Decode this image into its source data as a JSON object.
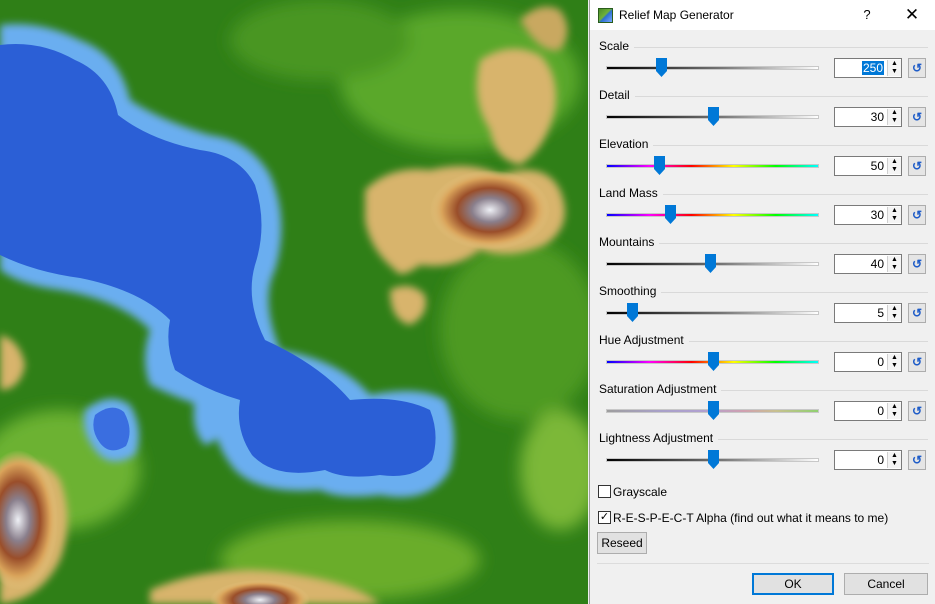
{
  "dialog": {
    "title": "Relief Map Generator",
    "help_label": "?",
    "close_label": "✕",
    "icon": "relief-map-app-icon",
    "accent_color": "#0078d7"
  },
  "map": {
    "icon": "terrain-preview",
    "colors": {
      "water_deep": "#2b5fd6",
      "water_shallow": "#6aaef0",
      "lowland": "#2f7f17",
      "grass": "#58a824",
      "hill": "#d9b36a",
      "mountain": "#9a4e2a",
      "snow": "#eef0f5"
    }
  },
  "controls": [
    {
      "label": "Scale",
      "value": "250",
      "slider_fraction": 0.26,
      "track": "gray",
      "selected": true
    },
    {
      "label": "Detail",
      "value": "30",
      "slider_fraction": 0.5,
      "track": "gray",
      "selected": false
    },
    {
      "label": "Elevation",
      "value": "50",
      "slider_fraction": 0.25,
      "track": "hue",
      "selected": false
    },
    {
      "label": "Land Mass",
      "value": "30",
      "slider_fraction": 0.3,
      "track": "hue",
      "selected": false
    },
    {
      "label": "Mountains",
      "value": "40",
      "slider_fraction": 0.49,
      "track": "gray",
      "selected": false
    },
    {
      "label": "Smoothing",
      "value": "5",
      "slider_fraction": 0.12,
      "track": "gray",
      "selected": false
    },
    {
      "label": "Hue Adjustment",
      "value": "0",
      "slider_fraction": 0.5,
      "track": "hue",
      "selected": false
    },
    {
      "label": "Saturation Adjustment",
      "value": "0",
      "slider_fraction": 0.5,
      "track": "sat",
      "selected": false
    },
    {
      "label": "Lightness Adjustment",
      "value": "0",
      "slider_fraction": 0.5,
      "track": "gray",
      "selected": false
    }
  ],
  "options": {
    "grayscale_label": "Grayscale",
    "grayscale_checked": false,
    "alpha_label": "R-E-S-P-E-C-T Alpha (find out what it means to me)",
    "alpha_checked": true,
    "reseed_label": "Reseed",
    "check_mark": "✓"
  },
  "footer": {
    "ok_label": "OK",
    "cancel_label": "Cancel"
  },
  "icons": {
    "reset": "↺",
    "spin_up": "▲",
    "spin_down": "▼"
  }
}
